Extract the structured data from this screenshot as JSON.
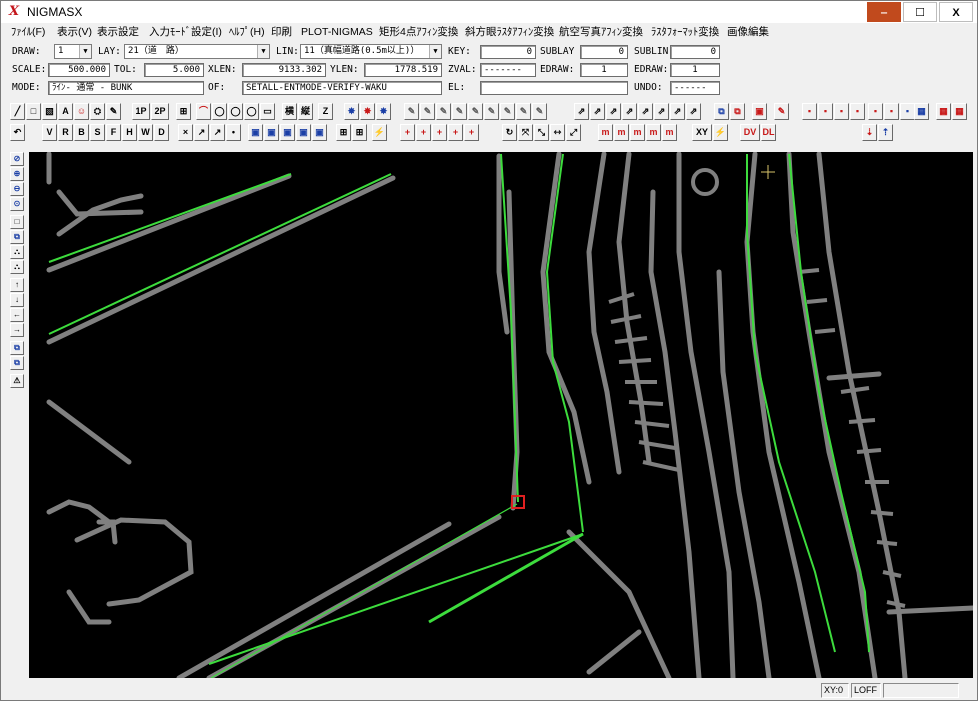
{
  "window": {
    "title": "NIGMASX",
    "logo_glyph": "X",
    "minimize_glyph": "‒",
    "maximize_glyph": "☐",
    "close_glyph": "X"
  },
  "menu": [
    "ﾌｧｲﾙ(F)",
    "表示(V)",
    "表示設定",
    "入力ﾓｰﾄﾞ設定(I)",
    "ﾍﾙﾌﾟ(H)",
    "印刷",
    "PLOT-NIGMAS",
    "矩形4点ｱﾌｨﾝ変換",
    "斜方眼ﾗｽﾀｱﾌｨﾝ変換",
    "航空写真ｱﾌｨﾝ変換",
    "ﾗｽﾀﾌｫｰﾏｯﾄ変換",
    "画像編集"
  ],
  "info": {
    "draw_label": "DRAW:",
    "draw_value": "1",
    "lay_label": "LAY:",
    "lay_value": "21（道　路）",
    "lin_label": "LIN:",
    "lin_value": "11（真幅道路(0.5m以上)）",
    "key_label": "KEY:",
    "key_value": "0",
    "sublay_label": "SUBLAY",
    "sublay_value": "0",
    "sublin_label": "SUBLIN:",
    "sublin_value": "0",
    "scale_label": "SCALE:",
    "scale_value": "500.000",
    "tol_label": "TOL:",
    "tol_value": "5.000",
    "xlen_label": "XLEN:",
    "xlen_value": "9133.302",
    "ylen_label": "YLEN:",
    "ylen_value": "1778.519",
    "zval_label": "ZVAL:",
    "zval_value": "-------",
    "edraw_label": "EDRAW:",
    "edraw_value": "1",
    "edraw2_label": "EDRAW:",
    "edraw2_value": "1",
    "mode_label": "MODE:",
    "mode_value": "ﾗｲﾝ- 通常 - BUNK",
    "of_label": "OF:",
    "of_value": "SETALL-ENTMODE-VERIFY-WAKU",
    "el_label": "EL:",
    "el_value": "",
    "undo_label": "UNDO:",
    "undo_value": "------"
  },
  "toolbar1": {
    "g1": [
      "╱",
      "□",
      "▧",
      "A",
      "☺",
      "⛭",
      "✎"
    ],
    "g2": [
      "1P",
      "2P"
    ],
    "g3": [
      "⊞"
    ],
    "g4": [
      "⌒",
      "◯",
      "◯",
      "◯",
      "▭"
    ],
    "g5": [
      "横",
      "縦"
    ],
    "g6": [
      "Z"
    ],
    "g7": [
      "✸",
      "✸",
      "✸"
    ],
    "g8": [
      "✎",
      "✎",
      "✎",
      "✎",
      "✎",
      "✎",
      "✎",
      "✎",
      "✎"
    ],
    "g9": [
      "⇗",
      "⇗",
      "⇗",
      "⇗",
      "⇗",
      "⇗",
      "⇗",
      "⇗"
    ],
    "g10": [
      "⧉",
      "⧉"
    ],
    "g11": [
      "▣"
    ],
    "g12": [
      "✎"
    ],
    "g13": [
      "▪",
      "▪",
      "▪",
      "▪"
    ],
    "g14": [
      "▪",
      "▪",
      "▪"
    ],
    "g15": [
      "▦"
    ],
    "g16": [
      "▦",
      "▦"
    ]
  },
  "toolbar2": {
    "g1": [
      "↶"
    ],
    "g2": [
      "V",
      "R",
      "B",
      "S",
      "F",
      "H",
      "W",
      "D"
    ],
    "g3": [
      "×",
      "↗",
      "↗",
      "•"
    ],
    "g4": [
      "▣",
      "▣",
      "▣",
      "▣",
      "▣"
    ],
    "g5": [
      "⊞",
      "⊞"
    ],
    "g6": [
      "⚡"
    ],
    "g7": [
      "+",
      "+",
      "+",
      "+",
      "+"
    ],
    "g8": [
      "↻",
      "⤧",
      "⤡",
      "⇿",
      "⤢"
    ],
    "g9": [
      "m",
      "m",
      "m",
      "m",
      "m"
    ],
    "g10": [
      "XY",
      "⚡"
    ],
    "g11": [
      "DV",
      "DL"
    ],
    "g12": [
      "⇣",
      "⇡"
    ]
  },
  "lefttoolbar": [
    "⊘",
    "⊕",
    "⊖",
    "⊙",
    "□",
    "⧉",
    "⛬",
    "⛬",
    "↑",
    "↓",
    "←",
    "→",
    "⧉",
    "⧉",
    "⚠"
  ],
  "status": {
    "xy": "XY:0",
    "loff": "LOFF",
    "extra": ""
  },
  "colors": {
    "canvas_bg": "#000000",
    "road_gray": "#808080",
    "line_green": "#3ddc3d",
    "selected_red": "#e02020",
    "titlebar_min_bg": "#c14a1d"
  }
}
